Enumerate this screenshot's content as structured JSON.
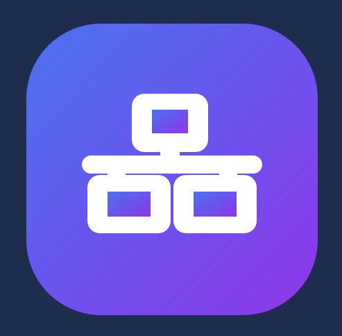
{
  "app_icon": {
    "icon": "network-icon",
    "gradient_start": "#4a73f0",
    "gradient_mid": "#6a54ec",
    "gradient_end": "#8e36e8",
    "glyph_color": "#ffffff",
    "background": "#1e2d4d"
  }
}
